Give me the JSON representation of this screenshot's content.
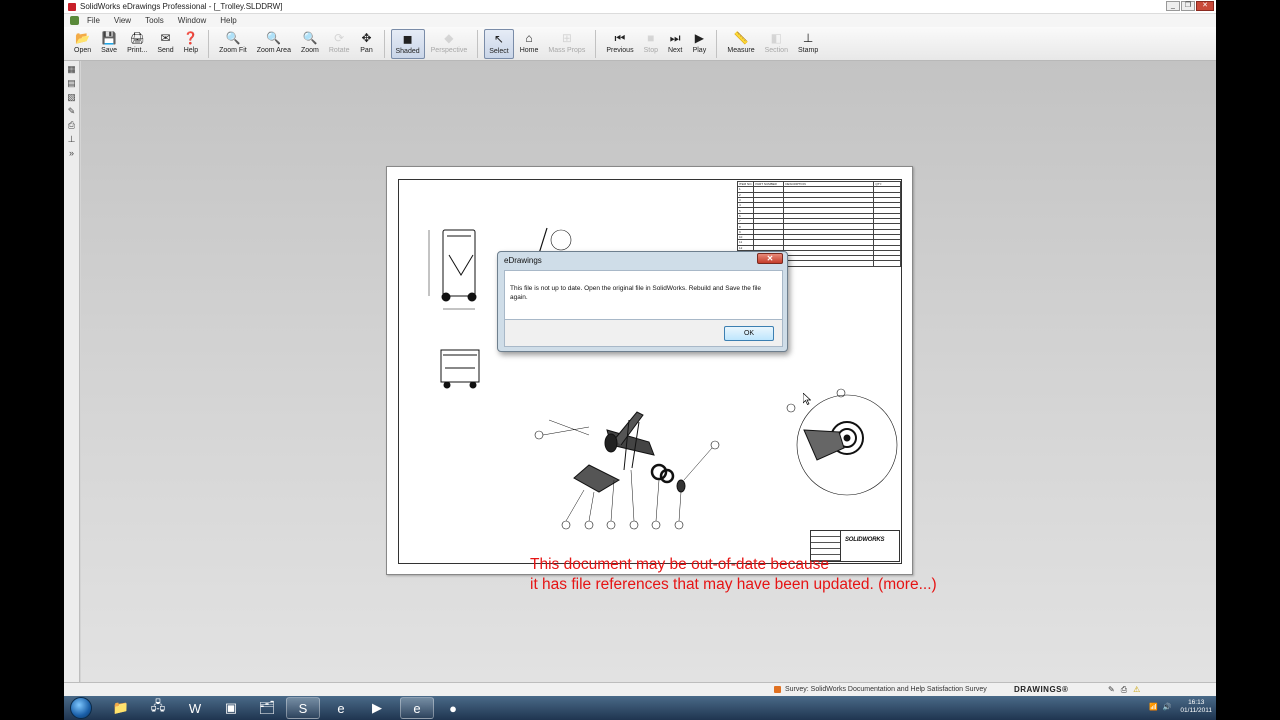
{
  "window": {
    "title": "SolidWorks eDrawings Professional - [_Trolley.SLDDRW]",
    "controls": [
      "_",
      "❐",
      "✕"
    ]
  },
  "menu": [
    "File",
    "View",
    "Tools",
    "Window",
    "Help"
  ],
  "toolbar": [
    {
      "label": "Open",
      "icon": "folder-open-icon",
      "glyph": "📂",
      "enabled": true
    },
    {
      "label": "Save",
      "icon": "save-icon",
      "glyph": "💾",
      "enabled": true
    },
    {
      "label": "Print...",
      "icon": "print-icon",
      "glyph": "🖨",
      "enabled": true
    },
    {
      "label": "Send",
      "icon": "send-icon",
      "glyph": "✉",
      "enabled": true
    },
    {
      "label": "Help",
      "icon": "help-icon",
      "glyph": "❓",
      "enabled": true
    },
    {
      "sep": true
    },
    {
      "label": "Zoom Fit",
      "icon": "zoom-fit-icon",
      "glyph": "🔍",
      "enabled": true
    },
    {
      "label": "Zoom Area",
      "icon": "zoom-area-icon",
      "glyph": "🔍",
      "enabled": true
    },
    {
      "label": "Zoom",
      "icon": "zoom-icon",
      "glyph": "🔍",
      "enabled": true
    },
    {
      "label": "Rotate",
      "icon": "rotate-icon",
      "glyph": "⟳",
      "enabled": false
    },
    {
      "label": "Pan",
      "icon": "pan-icon",
      "glyph": "✥",
      "enabled": true
    },
    {
      "sep": true
    },
    {
      "label": "Shaded",
      "icon": "shaded-icon",
      "glyph": "◼",
      "enabled": true,
      "active": true
    },
    {
      "label": "Perspective",
      "icon": "perspective-icon",
      "glyph": "◆",
      "enabled": false
    },
    {
      "sep": true
    },
    {
      "label": "Select",
      "icon": "select-cursor-icon",
      "glyph": "↖",
      "enabled": true,
      "active": true
    },
    {
      "label": "Home",
      "icon": "home-icon",
      "glyph": "⌂",
      "enabled": true
    },
    {
      "label": "Mass Props",
      "icon": "mass-props-icon",
      "glyph": "⊞",
      "enabled": false
    },
    {
      "sep": true
    },
    {
      "label": "Previous",
      "icon": "previous-icon",
      "glyph": "⏮",
      "enabled": true
    },
    {
      "label": "Stop",
      "icon": "stop-icon",
      "glyph": "■",
      "enabled": false
    },
    {
      "label": "Next",
      "icon": "next-icon",
      "glyph": "⏭",
      "enabled": true
    },
    {
      "label": "Play",
      "icon": "play-icon",
      "glyph": "▶",
      "enabled": true
    },
    {
      "sep": true
    },
    {
      "label": "Measure",
      "icon": "measure-icon",
      "glyph": "📏",
      "enabled": true
    },
    {
      "label": "Section",
      "icon": "section-icon",
      "glyph": "◧",
      "enabled": false
    },
    {
      "label": "Stamp",
      "icon": "stamp-icon",
      "glyph": "⊥",
      "enabled": true
    }
  ],
  "leftstrip": [
    "sheet-icon",
    "component-icon",
    "layers-icon",
    "markup-pen-icon",
    "print-setup-icon",
    "stamp-small-icon",
    "expand-icon"
  ],
  "bom": {
    "header": [
      "ITEM NO.",
      "PART NUMBER",
      "DESCRIPTION",
      "QTY."
    ],
    "rows": [
      [
        "1",
        "",
        "",
        ""
      ],
      [
        "2",
        "",
        "",
        ""
      ],
      [
        "3",
        "",
        "",
        ""
      ],
      [
        "4",
        "",
        "",
        ""
      ],
      [
        "5",
        "",
        "",
        ""
      ],
      [
        "6",
        "",
        "",
        ""
      ],
      [
        "7",
        "",
        "",
        ""
      ],
      [
        "8",
        "",
        "",
        ""
      ],
      [
        "9",
        "",
        "",
        ""
      ],
      [
        "10",
        "",
        "",
        ""
      ],
      [
        "11",
        "",
        "",
        ""
      ],
      [
        "12",
        "",
        "",
        ""
      ],
      [
        "13",
        "",
        "",
        ""
      ],
      [
        "14",
        "",
        "",
        ""
      ],
      [
        "15",
        "",
        "",
        ""
      ]
    ]
  },
  "titleblock": {
    "logo": "SOLIDWORKS"
  },
  "dialog": {
    "title": "eDrawings",
    "close_label": "✕",
    "message": "This file is not up to date. Open the original file in SolidWorks. Rebuild and Save the file again.",
    "ok_label": "OK"
  },
  "notice": {
    "line1": "This document may be out-of-date because",
    "line2": "it has file references that may have been updated. (more...)"
  },
  "status": {
    "survey": "Survey: SolidWorks Documentation and Help Satisfaction Survey",
    "brand": "DRAWINGS®"
  },
  "taskbar": {
    "apps": [
      {
        "name": "explorer-icon",
        "glyph": "📁"
      },
      {
        "name": "network-icon",
        "glyph": "🖧"
      },
      {
        "name": "word-icon",
        "glyph": "W"
      },
      {
        "name": "terminal-icon",
        "glyph": "▣"
      },
      {
        "name": "files-icon",
        "glyph": "🗂"
      },
      {
        "name": "solidworks-icon",
        "glyph": "S"
      },
      {
        "name": "ie-icon",
        "glyph": "e"
      },
      {
        "name": "media-icon",
        "glyph": "▶"
      },
      {
        "name": "edrawings-icon",
        "glyph": "e"
      },
      {
        "name": "green-app-icon",
        "glyph": "●"
      }
    ],
    "time": "16:13",
    "date": "01/11/2011"
  }
}
